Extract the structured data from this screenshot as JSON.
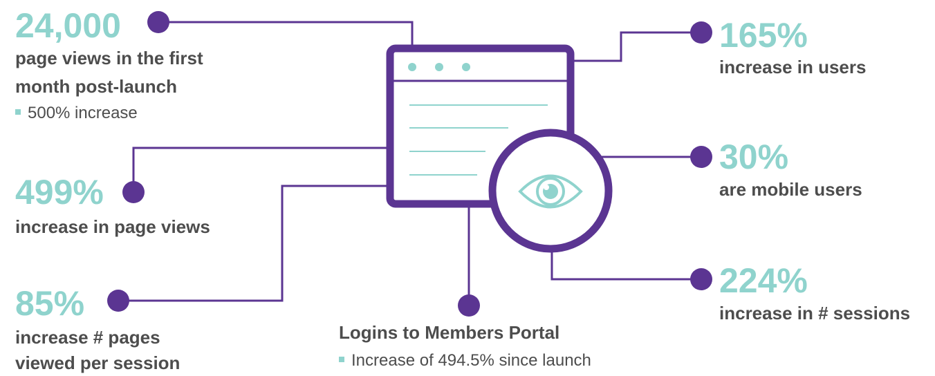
{
  "stats": {
    "page_views": {
      "value": "24,000",
      "label_line1": "page views in the first",
      "label_line2": "month post-launch",
      "sub": "500% increase"
    },
    "page_views_increase": {
      "value": "499%",
      "label": "increase in page views"
    },
    "pages_per_session": {
      "value": "85%",
      "label_line1": "increase # pages",
      "label_line2": "viewed per session"
    },
    "logins": {
      "label": "Logins to Members Portal",
      "sub": "Increase of 494.5% since launch"
    },
    "users": {
      "value": "165%",
      "label": "increase in users"
    },
    "mobile": {
      "value": "30%",
      "label": "are mobile users"
    },
    "sessions": {
      "value": "224%",
      "label": "increase in # sessions"
    }
  },
  "colors": {
    "purple": "#5b3592",
    "teal": "#8fd3cd",
    "text": "#4d4d4d"
  },
  "icons": [
    "browser-window-icon",
    "eye-icon"
  ]
}
